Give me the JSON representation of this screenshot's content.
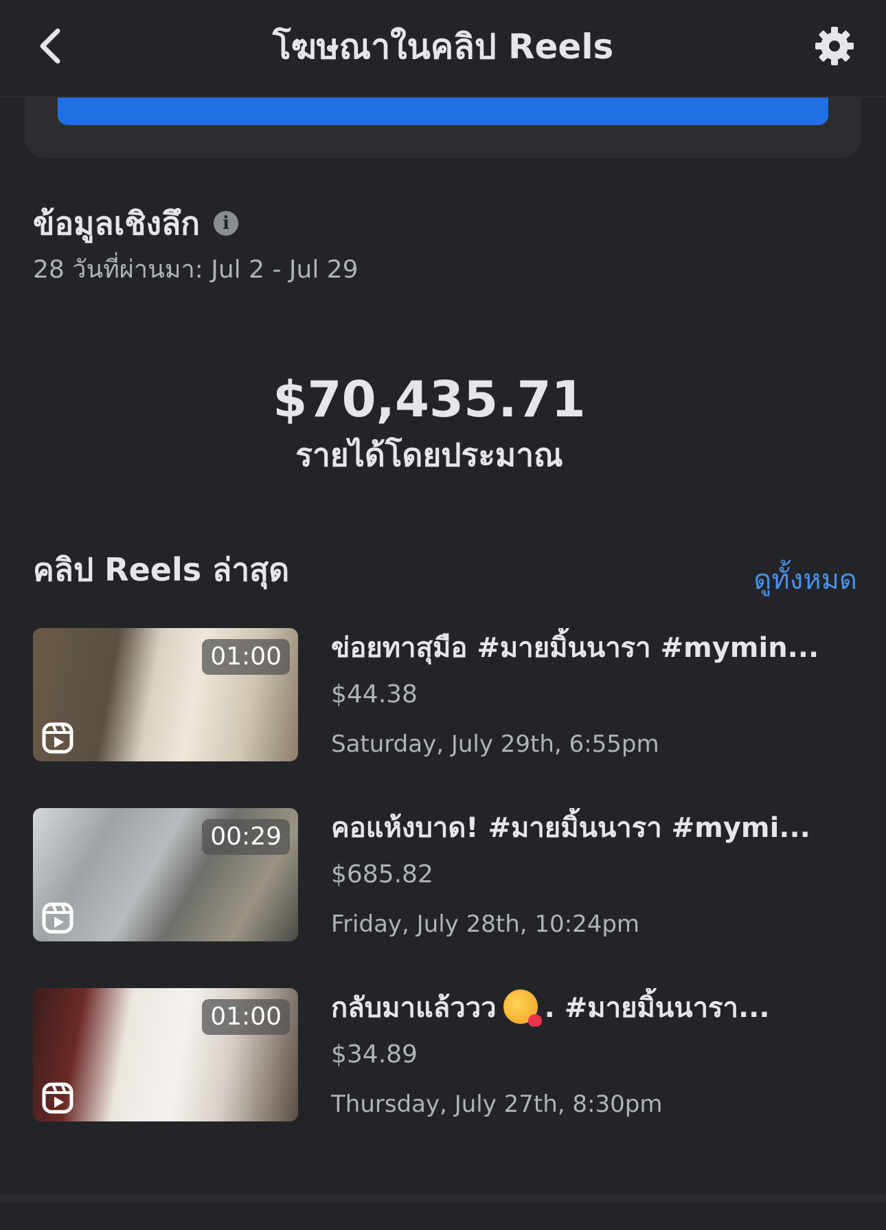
{
  "header": {
    "title": "โฆษณาในคลิป Reels",
    "back_icon": "chevron-left-icon",
    "settings_icon": "gear-icon"
  },
  "insights": {
    "title": "ข้อมูลเชิงลึก",
    "info_icon": "info-icon",
    "date_range": "28 วันที่ผ่านมา: Jul 2 - Jul 29"
  },
  "revenue": {
    "amount": "$70,435.71",
    "label": "รายได้โดยประมาณ"
  },
  "reels": {
    "title": "คลิป Reels ล่าสุด",
    "see_all": "ดูทั้งหมด",
    "items": [
      {
        "title": "ข่อยทาสุมือ #มายมิ้นนารา #mymin...",
        "earnings": "$44.38",
        "date": "Saturday, July 29th, 6:55pm",
        "duration": "01:00"
      },
      {
        "title": "คอแห้งบาด! #มายมิ้นนารา #mymi...",
        "earnings": "$685.82",
        "date": "Friday, July 28th, 10:24pm",
        "duration": "00:29"
      },
      {
        "title_before": "กลับมาแล้ววว",
        "title_after": ". #มายมิ้นนารา...",
        "emoji": "smiling-face-with-hearts",
        "earnings": "$34.89",
        "date": "Thursday, July 27th, 8:30pm",
        "duration": "01:00"
      }
    ]
  },
  "colors": {
    "background": "#232428",
    "accent_blue": "#1f6fe5",
    "link_blue": "#4a90e8",
    "secondary_text": "#b0b3b8"
  }
}
